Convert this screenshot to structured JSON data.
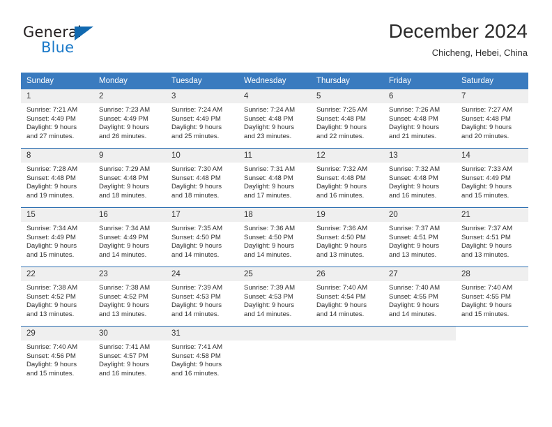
{
  "brand": {
    "word_one": "General",
    "word_two": "Blue",
    "logo_icon": "triangle-logo-icon",
    "accent_color": "#1169b0"
  },
  "header": {
    "title": "December 2024",
    "subtitle": "Chicheng, Hebei, China"
  },
  "colors": {
    "weekday_header_bg": "#3a7bbf",
    "day_number_band_bg": "#efefef",
    "row_divider": "#2a6db0",
    "text": "#2f2f2f"
  },
  "weekdays": [
    {
      "label": "Sunday"
    },
    {
      "label": "Monday"
    },
    {
      "label": "Tuesday"
    },
    {
      "label": "Wednesday"
    },
    {
      "label": "Thursday"
    },
    {
      "label": "Friday"
    },
    {
      "label": "Saturday"
    }
  ],
  "weeks": [
    {
      "days": [
        {
          "num": "1",
          "sunrise": "Sunrise: 7:21 AM",
          "sunset": "Sunset: 4:49 PM",
          "daylight1": "Daylight: 9 hours",
          "daylight2": "and 27 minutes."
        },
        {
          "num": "2",
          "sunrise": "Sunrise: 7:23 AM",
          "sunset": "Sunset: 4:49 PM",
          "daylight1": "Daylight: 9 hours",
          "daylight2": "and 26 minutes."
        },
        {
          "num": "3",
          "sunrise": "Sunrise: 7:24 AM",
          "sunset": "Sunset: 4:49 PM",
          "daylight1": "Daylight: 9 hours",
          "daylight2": "and 25 minutes."
        },
        {
          "num": "4",
          "sunrise": "Sunrise: 7:24 AM",
          "sunset": "Sunset: 4:48 PM",
          "daylight1": "Daylight: 9 hours",
          "daylight2": "and 23 minutes."
        },
        {
          "num": "5",
          "sunrise": "Sunrise: 7:25 AM",
          "sunset": "Sunset: 4:48 PM",
          "daylight1": "Daylight: 9 hours",
          "daylight2": "and 22 minutes."
        },
        {
          "num": "6",
          "sunrise": "Sunrise: 7:26 AM",
          "sunset": "Sunset: 4:48 PM",
          "daylight1": "Daylight: 9 hours",
          "daylight2": "and 21 minutes."
        },
        {
          "num": "7",
          "sunrise": "Sunrise: 7:27 AM",
          "sunset": "Sunset: 4:48 PM",
          "daylight1": "Daylight: 9 hours",
          "daylight2": "and 20 minutes."
        }
      ]
    },
    {
      "days": [
        {
          "num": "8",
          "sunrise": "Sunrise: 7:28 AM",
          "sunset": "Sunset: 4:48 PM",
          "daylight1": "Daylight: 9 hours",
          "daylight2": "and 19 minutes."
        },
        {
          "num": "9",
          "sunrise": "Sunrise: 7:29 AM",
          "sunset": "Sunset: 4:48 PM",
          "daylight1": "Daylight: 9 hours",
          "daylight2": "and 18 minutes."
        },
        {
          "num": "10",
          "sunrise": "Sunrise: 7:30 AM",
          "sunset": "Sunset: 4:48 PM",
          "daylight1": "Daylight: 9 hours",
          "daylight2": "and 18 minutes."
        },
        {
          "num": "11",
          "sunrise": "Sunrise: 7:31 AM",
          "sunset": "Sunset: 4:48 PM",
          "daylight1": "Daylight: 9 hours",
          "daylight2": "and 17 minutes."
        },
        {
          "num": "12",
          "sunrise": "Sunrise: 7:32 AM",
          "sunset": "Sunset: 4:48 PM",
          "daylight1": "Daylight: 9 hours",
          "daylight2": "and 16 minutes."
        },
        {
          "num": "13",
          "sunrise": "Sunrise: 7:32 AM",
          "sunset": "Sunset: 4:48 PM",
          "daylight1": "Daylight: 9 hours",
          "daylight2": "and 16 minutes."
        },
        {
          "num": "14",
          "sunrise": "Sunrise: 7:33 AM",
          "sunset": "Sunset: 4:49 PM",
          "daylight1": "Daylight: 9 hours",
          "daylight2": "and 15 minutes."
        }
      ]
    },
    {
      "days": [
        {
          "num": "15",
          "sunrise": "Sunrise: 7:34 AM",
          "sunset": "Sunset: 4:49 PM",
          "daylight1": "Daylight: 9 hours",
          "daylight2": "and 15 minutes."
        },
        {
          "num": "16",
          "sunrise": "Sunrise: 7:34 AM",
          "sunset": "Sunset: 4:49 PM",
          "daylight1": "Daylight: 9 hours",
          "daylight2": "and 14 minutes."
        },
        {
          "num": "17",
          "sunrise": "Sunrise: 7:35 AM",
          "sunset": "Sunset: 4:50 PM",
          "daylight1": "Daylight: 9 hours",
          "daylight2": "and 14 minutes."
        },
        {
          "num": "18",
          "sunrise": "Sunrise: 7:36 AM",
          "sunset": "Sunset: 4:50 PM",
          "daylight1": "Daylight: 9 hours",
          "daylight2": "and 14 minutes."
        },
        {
          "num": "19",
          "sunrise": "Sunrise: 7:36 AM",
          "sunset": "Sunset: 4:50 PM",
          "daylight1": "Daylight: 9 hours",
          "daylight2": "and 13 minutes."
        },
        {
          "num": "20",
          "sunrise": "Sunrise: 7:37 AM",
          "sunset": "Sunset: 4:51 PM",
          "daylight1": "Daylight: 9 hours",
          "daylight2": "and 13 minutes."
        },
        {
          "num": "21",
          "sunrise": "Sunrise: 7:37 AM",
          "sunset": "Sunset: 4:51 PM",
          "daylight1": "Daylight: 9 hours",
          "daylight2": "and 13 minutes."
        }
      ]
    },
    {
      "days": [
        {
          "num": "22",
          "sunrise": "Sunrise: 7:38 AM",
          "sunset": "Sunset: 4:52 PM",
          "daylight1": "Daylight: 9 hours",
          "daylight2": "and 13 minutes."
        },
        {
          "num": "23",
          "sunrise": "Sunrise: 7:38 AM",
          "sunset": "Sunset: 4:52 PM",
          "daylight1": "Daylight: 9 hours",
          "daylight2": "and 13 minutes."
        },
        {
          "num": "24",
          "sunrise": "Sunrise: 7:39 AM",
          "sunset": "Sunset: 4:53 PM",
          "daylight1": "Daylight: 9 hours",
          "daylight2": "and 14 minutes."
        },
        {
          "num": "25",
          "sunrise": "Sunrise: 7:39 AM",
          "sunset": "Sunset: 4:53 PM",
          "daylight1": "Daylight: 9 hours",
          "daylight2": "and 14 minutes."
        },
        {
          "num": "26",
          "sunrise": "Sunrise: 7:40 AM",
          "sunset": "Sunset: 4:54 PM",
          "daylight1": "Daylight: 9 hours",
          "daylight2": "and 14 minutes."
        },
        {
          "num": "27",
          "sunrise": "Sunrise: 7:40 AM",
          "sunset": "Sunset: 4:55 PM",
          "daylight1": "Daylight: 9 hours",
          "daylight2": "and 14 minutes."
        },
        {
          "num": "28",
          "sunrise": "Sunrise: 7:40 AM",
          "sunset": "Sunset: 4:55 PM",
          "daylight1": "Daylight: 9 hours",
          "daylight2": "and 15 minutes."
        }
      ]
    },
    {
      "days": [
        {
          "num": "29",
          "sunrise": "Sunrise: 7:40 AM",
          "sunset": "Sunset: 4:56 PM",
          "daylight1": "Daylight: 9 hours",
          "daylight2": "and 15 minutes."
        },
        {
          "num": "30",
          "sunrise": "Sunrise: 7:41 AM",
          "sunset": "Sunset: 4:57 PM",
          "daylight1": "Daylight: 9 hours",
          "daylight2": "and 16 minutes."
        },
        {
          "num": "31",
          "sunrise": "Sunrise: 7:41 AM",
          "sunset": "Sunset: 4:58 PM",
          "daylight1": "Daylight: 9 hours",
          "daylight2": "and 16 minutes."
        },
        {
          "num": "",
          "sunrise": "",
          "sunset": "",
          "daylight1": "",
          "daylight2": ""
        },
        {
          "num": "",
          "sunrise": "",
          "sunset": "",
          "daylight1": "",
          "daylight2": ""
        },
        {
          "num": "",
          "sunrise": "",
          "sunset": "",
          "daylight1": "",
          "daylight2": ""
        },
        {
          "num": "",
          "sunrise": "",
          "sunset": "",
          "daylight1": "",
          "daylight2": ""
        }
      ]
    }
  ]
}
